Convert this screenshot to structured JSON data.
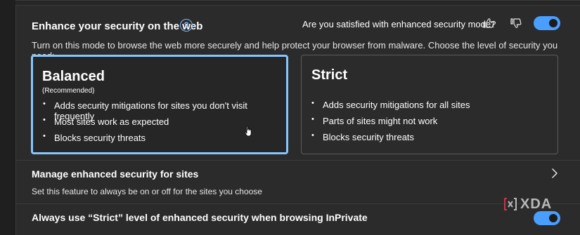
{
  "header": {
    "title": "Enhance your security on the web",
    "help_icon": "?",
    "feedback_question": "Are you satisfied with enhanced security mode?",
    "thumbs_up_icon": "thumbs-up-icon",
    "thumbs_down_icon": "thumbs-down-icon",
    "toggle_state": "on"
  },
  "description": "Turn on this mode to browse the web more securely and help protect your browser from malware. Choose the level of security you need:",
  "cards": [
    {
      "title": "Balanced",
      "subtitle": "(Recommended)",
      "selected": true,
      "bullets": [
        "Adds security mitigations for sites you don't visit frequently",
        "Most sites work as expected",
        "Blocks security threats"
      ]
    },
    {
      "title": "Strict",
      "selected": false,
      "bullets": [
        "Adds security mitigations for all sites",
        "Parts of sites might not work",
        "Blocks security threats"
      ]
    }
  ],
  "manage": {
    "title": "Manage enhanced security for sites",
    "description": "Set this feature to always be on or off for the sites you choose"
  },
  "inprivate": {
    "title": "Always use “Strict” level of enhanced security when browsing InPrivate",
    "toggle_state": "on"
  },
  "watermark": {
    "text": "XDA"
  },
  "colors": {
    "accent": "#4a9eff",
    "selected_border": "#85c6ff",
    "background": "#2b2b2b"
  }
}
